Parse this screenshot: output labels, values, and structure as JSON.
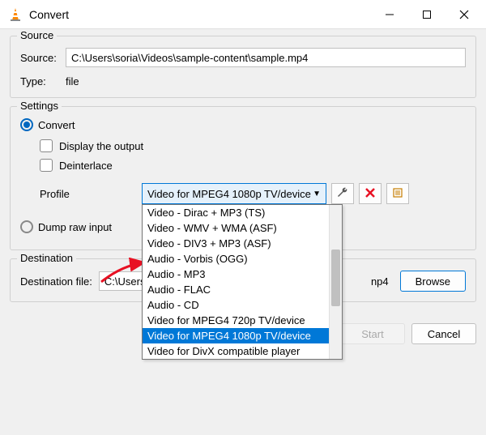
{
  "window": {
    "title": "Convert"
  },
  "source_group": {
    "label": "Source",
    "source_label": "Source:",
    "source_value": "C:\\Users\\soria\\Videos\\sample-content\\sample.mp4",
    "type_label": "Type:",
    "type_value": "file"
  },
  "settings_group": {
    "label": "Settings",
    "convert_label": "Convert",
    "display_output_label": "Display the output",
    "deinterlace_label": "Deinterlace",
    "profile_label": "Profile",
    "profile_selected": "Video for MPEG4 1080p TV/device",
    "profile_options": [
      "Video - Dirac + MP3 (TS)",
      "Video - WMV + WMA (ASF)",
      "Video - DIV3 + MP3 (ASF)",
      "Audio - Vorbis (OGG)",
      "Audio - MP3",
      "Audio - FLAC",
      "Audio - CD",
      "Video for MPEG4 720p TV/device",
      "Video for MPEG4 1080p TV/device",
      "Video for DivX compatible player"
    ],
    "dump_raw_label": "Dump raw input"
  },
  "destination_group": {
    "label": "Destination",
    "dest_file_label": "Destination file:",
    "dest_file_value": "C:\\Users",
    "dest_file_suffix": "np4",
    "browse_label": "Browse"
  },
  "footer": {
    "start_label": "Start",
    "cancel_label": "Cancel"
  }
}
